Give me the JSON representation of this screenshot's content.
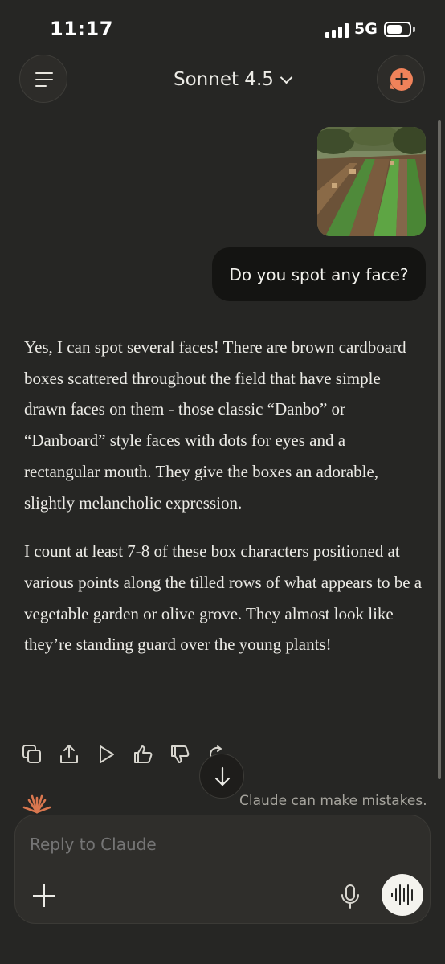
{
  "status_bar": {
    "time": "11:17",
    "network": "5G",
    "signal_bars": 4,
    "battery_icon": "battery-icon"
  },
  "header": {
    "menu_icon": "menu-icon",
    "model_name": "Sonnet 4.5",
    "model_chevron_icon": "chevron-down-icon",
    "new_chat_icon": "new-chat-icon"
  },
  "conversation": {
    "user_image": {
      "kind": "attached-photo",
      "depicts": "field with tilled rows and green plants"
    },
    "user_message": "Do you spot any face?",
    "assistant_paragraphs": [
      "Yes, I can spot several faces! There are brown cardboard boxes scattered throughout the field that have simple drawn faces on them - those classic “Danbo” or “Danboard” style faces with dots for eyes and a rectangular mouth. They give the boxes an adorable, slightly melancholic expression.",
      "I count at least 7-8 of these box characters positioned at various points along the tilled rows of what appears to be a vegetable garden or olive grove. They almost look like they’re standing guard over the young plants!"
    ],
    "action_icons": [
      "copy-icon",
      "share-icon",
      "play-icon",
      "thumbs-up-icon",
      "thumbs-down-icon",
      "retry-icon"
    ]
  },
  "footer": {
    "scroll_down_icon": "arrow-down-icon",
    "disclaimer": "Claude can make mistakes.",
    "composer": {
      "placeholder": "Reply to Claude",
      "value": "",
      "add_icon": "plus-icon",
      "mic_icon": "microphone-icon",
      "voice_icon": "voice-waveform-icon"
    }
  },
  "colors": {
    "background": "#262624",
    "user_bubble": "#141412",
    "accent": "#f0825a",
    "text": "#ecebe6",
    "muted": "#a7a59e"
  }
}
